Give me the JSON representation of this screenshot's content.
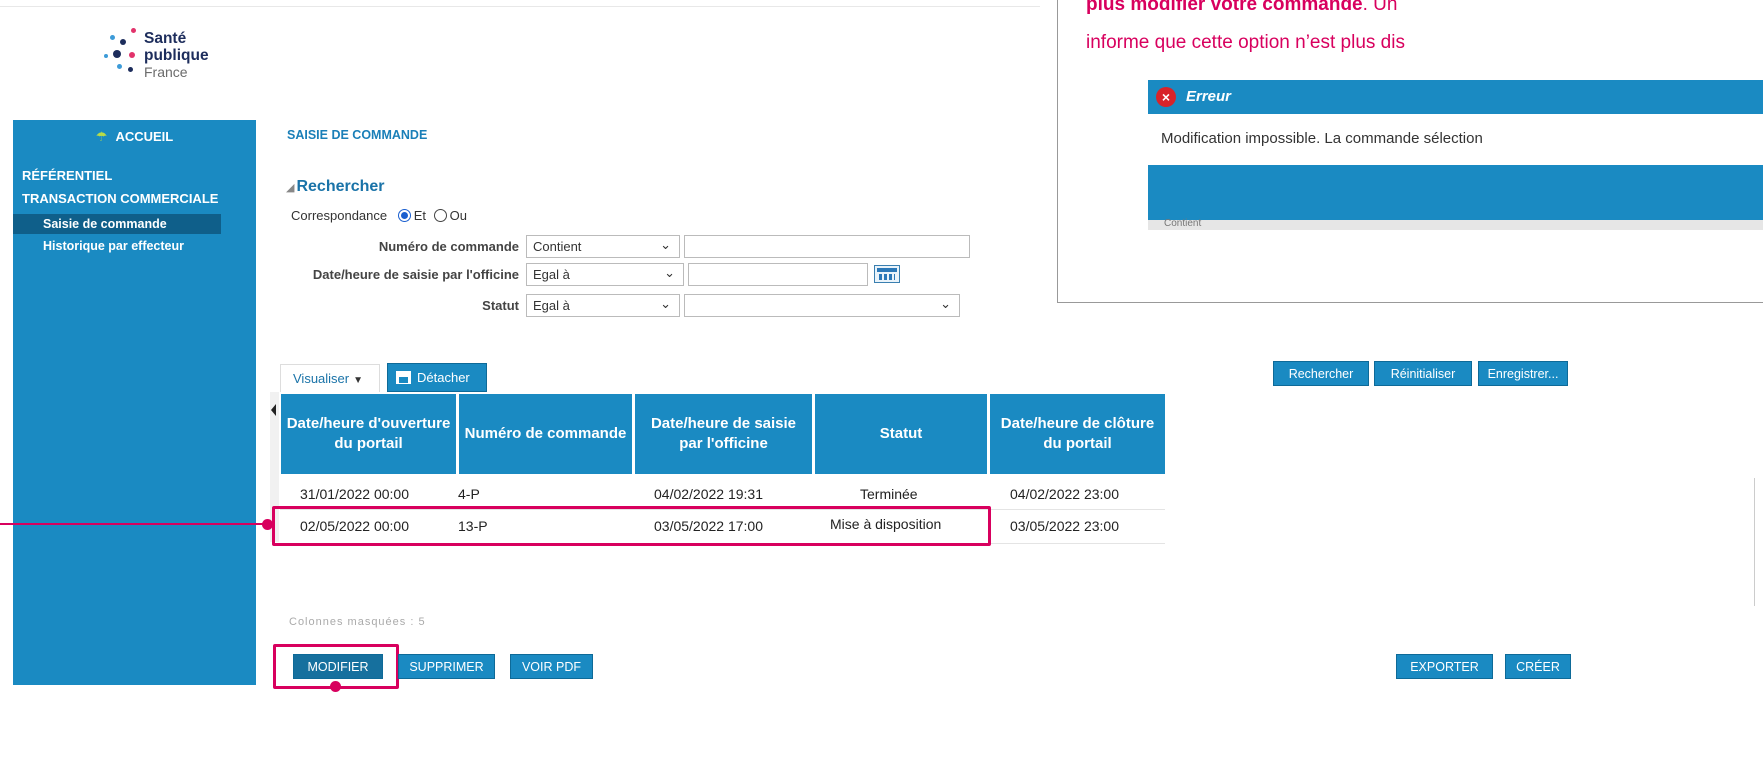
{
  "logo": {
    "line1": "Santé",
    "line2": "publique",
    "line3": "France"
  },
  "sidebar": {
    "home": "ACCUEIL",
    "items": [
      {
        "label": "RÉFÉRENTIEL"
      },
      {
        "label": "TRANSACTION COMMERCIALE"
      }
    ],
    "subitems": [
      {
        "label": "Saisie de commande",
        "active": true
      },
      {
        "label": "Historique par effecteur",
        "active": false
      }
    ]
  },
  "page": {
    "title": "SAISIE DE COMMANDE"
  },
  "search": {
    "title": "Rechercher",
    "match_label": "Correspondance",
    "match_options": [
      "Et",
      "Ou"
    ],
    "fields": [
      {
        "label": "Numéro de commande",
        "operator": "Contient",
        "value": ""
      },
      {
        "label": "Date/heure de saisie par l'officine",
        "operator": "Egal à",
        "value": ""
      },
      {
        "label": "Statut",
        "operator": "Egal à",
        "value": ""
      }
    ]
  },
  "toolbar": {
    "visualiser": "Visualiser",
    "detacher": "Détacher"
  },
  "table": {
    "columns": [
      "Date/heure d'ouverture du portail",
      "Numéro de commande",
      "Date/heure de saisie par l'officine",
      "Statut",
      "Date/heure de clôture du portail"
    ],
    "rows": [
      [
        "31/01/2022 00:00",
        "4-P",
        "04/02/2022 19:31",
        "Terminée",
        "04/02/2022 23:00"
      ],
      [
        "02/05/2022 00:00",
        "13-P",
        "03/05/2022 17:00",
        "Mise à disposition",
        "03/05/2022 23:00"
      ]
    ],
    "hidden_columns_text": "Colonnes masquées : 5"
  },
  "actions": {
    "modifier": "MODIFIER",
    "supprimer": "SUPPRIMER",
    "voir_pdf": "VOIR PDF",
    "exporter": "EXPORTER",
    "creer": "CRÉER"
  },
  "right_panel": {
    "callout_bold": "plus modifier votre commande",
    "callout_rest": ". Un",
    "callout_line2": "informe que cette option n’est plus dis",
    "dialog_title": "Erreur",
    "dialog_message": "Modification impossible. La commande sélection",
    "shadow_text": "Contient",
    "buttons": {
      "rechercher": "Rechercher",
      "reinitialiser": "Réinitialiser",
      "enregistrer": "Enregistrer..."
    }
  },
  "colors": {
    "primary": "#1a8ac2",
    "highlight": "#d8005e",
    "active_nav": "#0f5f8a"
  }
}
